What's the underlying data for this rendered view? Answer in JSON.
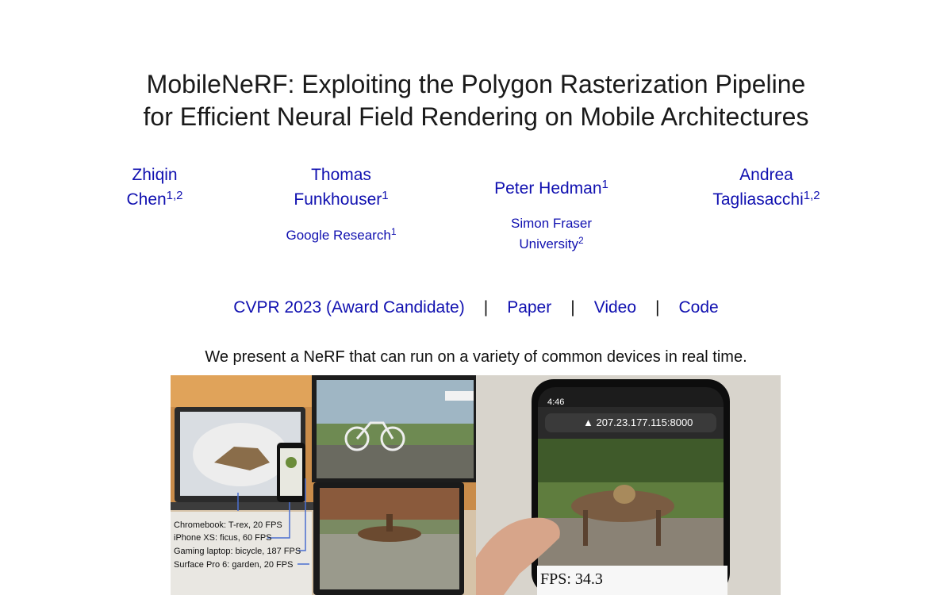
{
  "title": {
    "line1": "MobileNeRF: Exploiting the Polygon Rasterization Pipeline",
    "line2": "for Efficient Neural Field Rendering on Mobile Architectures"
  },
  "authors": [
    {
      "line1": "Zhiqin",
      "line2": "Chen",
      "sup": "1,2"
    },
    {
      "line1": "Thomas",
      "line2": "Funkhouser",
      "sup": "1"
    },
    {
      "line1": "Peter Hedman",
      "line2": "",
      "sup": "1"
    },
    {
      "line1": "Andrea",
      "line2": "Tagliasacchi",
      "sup": "1,2"
    }
  ],
  "affiliations": [
    {
      "line1": "Google Research",
      "line2": "",
      "sup": "1"
    },
    {
      "line1": "Simon Fraser",
      "line2": "University",
      "sup": "2"
    }
  ],
  "links": {
    "venue": "CVPR 2023 (Award Candidate)",
    "paper": "Paper",
    "video": "Video",
    "code": "Code",
    "separator": "|"
  },
  "caption": "We present a NeRF that can run on a variety of common devices in real time.",
  "teaser": {
    "devices": [
      "Chromebook: T-rex, 20 FPS",
      "iPhone XS: ficus, 60 FPS",
      "Gaming laptop: bicycle, 187 FPS",
      "Surface Pro 6: garden, 20 FPS"
    ],
    "phone_url": "▲ 207.23.177.115:8000",
    "phone_time": "4:46",
    "fps_readout": "FPS: 34.3"
  }
}
